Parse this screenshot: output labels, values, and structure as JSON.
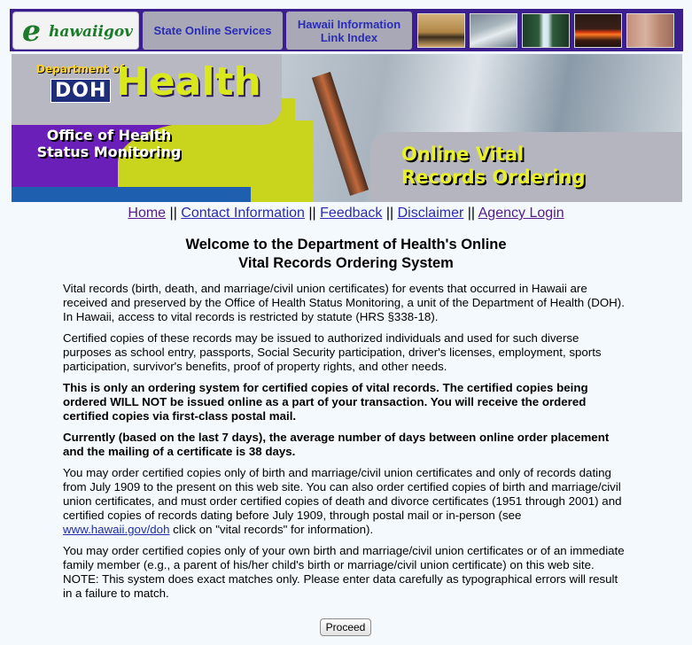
{
  "header": {
    "logo_text": "hawaiigov",
    "logo_letter": "e",
    "nav": [
      {
        "label": "State Online Services"
      },
      {
        "label": "Hawaii Information Link Index"
      }
    ]
  },
  "banner": {
    "dept_label": "Department of",
    "doh_label": "DOH",
    "health_label": "Health",
    "office_label": "Office of Health Status Monitoring",
    "service_label": "Online Vital Records Ordering"
  },
  "links": {
    "home": "Home",
    "contact": "Contact Information",
    "feedback": "Feedback",
    "disclaimer": "Disclaimer",
    "agency_login": "Agency Login",
    "separator": "||"
  },
  "main": {
    "title_line1": "Welcome to the Department of Health's Online",
    "title_line2": "Vital Records Ordering System",
    "p1": "Vital records (birth, death, and marriage/civil union certificates) for events that occurred in Hawaii are received and preserved by the Office of Health Status Monitoring, a unit of the Department of Health (DOH). In Hawaii, access to vital records is restricted by statute (HRS §338-18).",
    "p2": "Certified copies of these records may be issued to authorized individuals and used for such diverse purposes as school entry, passports, Social Security participation, driver's licenses, employment, sports participation, survivor's benefits, proof of property rights, and other needs.",
    "p3": "This is only an ordering system for certified copies of vital records. The certified copies being ordered WILL NOT be issued online as a part of your transaction. You will receive the ordered certified copies via first-class postal mail.",
    "p4": "Currently (based on the last 7 days), the average number of days between online order placement and the mailing of a certificate is 38 days.",
    "p5_before": "You may order certified copies only of birth and marriage/civil union certificates and only of records dating from July 1909 to the present on this web site. You can also order certified copies of birth and marriage/civil union certificates, and must order certified copies of death and divorce certificates (1951 through 2001) and certified copies of records dating before July 1909, through postal mail or in-person (see ",
    "p5_link": "www.hawaii.gov/doh",
    "p5_after": " click on \"vital records\" for information).",
    "p6": "You may order certified copies only of your own birth and marriage/civil union certificates or of an immediate family member (e.g., a parent of his/her child's birth or marriage/civil union certificate) on this web site. NOTE: This system does exact matches only. Please enter data carefully as typographical errors will result in a failure to match.",
    "proceed_label": "Proceed"
  }
}
